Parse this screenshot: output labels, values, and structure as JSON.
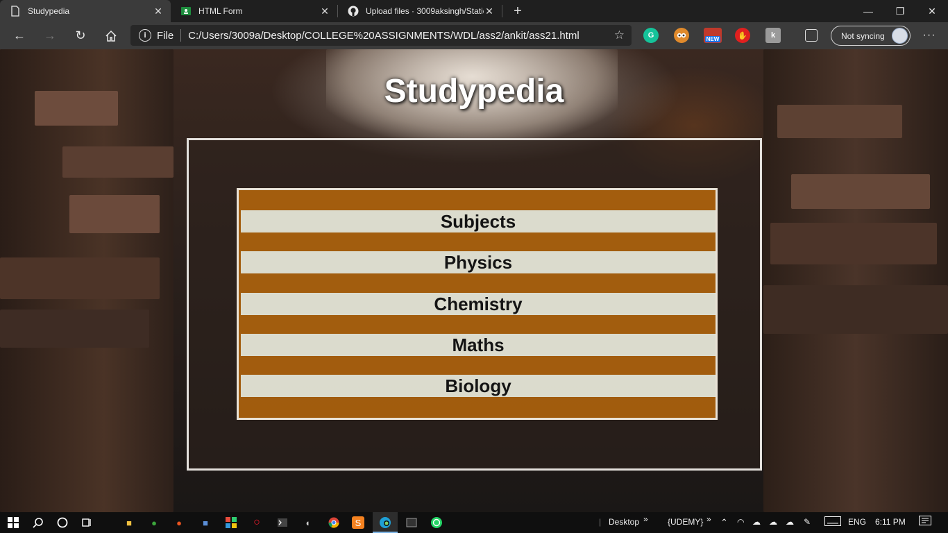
{
  "browser": {
    "tabs": [
      {
        "title": "Studypedia",
        "active": true,
        "icon": "document-icon"
      },
      {
        "title": "HTML Form",
        "active": false,
        "icon": "form-icon"
      },
      {
        "title": "Upload files · 3009aksingh/Static",
        "active": false,
        "icon": "github-icon"
      }
    ],
    "new_tab_glyph": "+",
    "address": {
      "scheme_label": "File",
      "url": "C:/Users/3009a/Desktop/COLLEGE%20ASSIGNMENTS/WDL/ass2/ankit/ass21.html"
    },
    "extensions": [
      {
        "name": "grammarly-icon",
        "label": "G",
        "color": "#15c39a"
      },
      {
        "name": "extension-owl-icon",
        "label": "",
        "color": "#e08a2c"
      },
      {
        "name": "extension-new-icon",
        "label": "NEW",
        "color": "#1a73e8"
      },
      {
        "name": "extension-hand-icon",
        "label": "",
        "color": "#e0201f"
      },
      {
        "name": "extension-k-icon",
        "label": "k",
        "color": "#9a9a9a"
      }
    ],
    "sync_label": "Not syncing"
  },
  "page": {
    "title": "Studypedia",
    "rows": [
      {
        "label": "Subjects"
      },
      {
        "label": "Physics"
      },
      {
        "label": "Chemistry"
      },
      {
        "label": "Maths"
      },
      {
        "label": "Biology"
      }
    ]
  },
  "taskbar": {
    "desktop_label": "Desktop",
    "udemy_label": "{UDEMY}",
    "language": "ENG",
    "time": "6:11 PM"
  }
}
